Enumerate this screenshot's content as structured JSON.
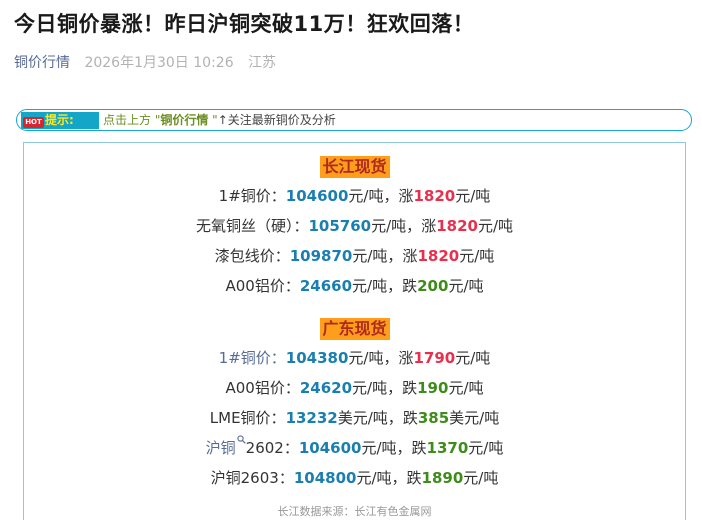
{
  "article": {
    "title": "今日铜价暴涨！昨日沪铜突破11万！狂欢回落！",
    "account": "铜价行情",
    "date": "2026年1月30日 10:26",
    "place": "江苏"
  },
  "tip": {
    "hot": "HOT",
    "label": "提示:",
    "text_prefix": "点击上方 \"",
    "brand": "铜价行情",
    "text_mid": " \"",
    "text_tail": "↑关注最新铜价及分析"
  },
  "sections": [
    {
      "title": "长江现货",
      "rows": [
        {
          "label": "1#铜价：",
          "price": "104600",
          "unit": "元/吨，",
          "dir": "涨",
          "change": "1820",
          "cunit": "元/吨"
        },
        {
          "label": "无氧铜丝（硬）：",
          "price": "105760",
          "unit": "元/吨，",
          "dir": "涨",
          "change": "1820",
          "cunit": "元/吨"
        },
        {
          "label": "漆包线价：",
          "price": "109870",
          "unit": "元/吨，",
          "dir": "涨",
          "change": "1820",
          "cunit": "元/吨"
        },
        {
          "label": "A00铝价：",
          "price": "24660",
          "unit": "元/吨，",
          "dir": "跌",
          "change": "200",
          "cunit": "元/吨"
        }
      ]
    },
    {
      "title": "广东现货",
      "rows": [
        {
          "label": "1#铜价：",
          "price": "104380",
          "unit": "元/吨，",
          "dir": "涨",
          "change": "1790",
          "cunit": "元/吨"
        },
        {
          "label": "A00铝价：",
          "price": "24620",
          "unit": "元/吨，",
          "dir": "跌",
          "change": "190",
          "cunit": "元/吨"
        },
        {
          "label": "LME铜价：",
          "price": "13232",
          "unit": "美元/吨，",
          "dir": "跌",
          "change": "385",
          "cunit": "美元/吨"
        },
        {
          "label_link": "沪铜",
          "label": "2602：",
          "price": "104600",
          "unit": "元/吨，",
          "dir": "跌",
          "change": "1370",
          "cunit": "元/吨"
        },
        {
          "label": "沪铜2603：",
          "price": "104800",
          "unit": "元/吨，",
          "dir": "跌",
          "change": "1890",
          "cunit": "元/吨"
        }
      ]
    }
  ],
  "source": "长江数据来源：长江有色金属网",
  "colors": {
    "price": "#1a7fb0",
    "rise": "#e8304d",
    "fall": "#3e8c19",
    "section_bg": "#ff9e1b"
  }
}
